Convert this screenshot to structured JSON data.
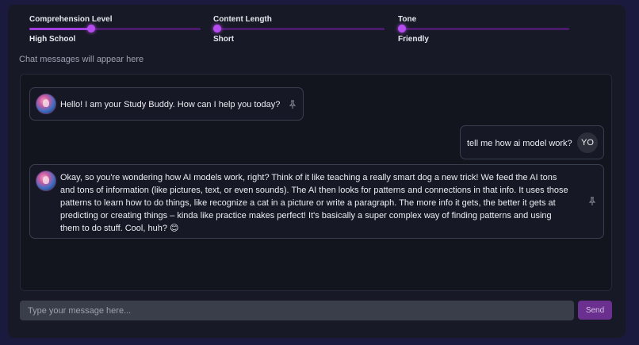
{
  "controls": {
    "comprehension": {
      "title": "Comprehension Level",
      "value": "High School",
      "level": 0.34
    },
    "length": {
      "title": "Content Length",
      "value": "Short",
      "level": 0.0
    },
    "tone": {
      "title": "Tone",
      "value": "Friendly",
      "level": 0.0
    }
  },
  "chat": {
    "hint": "Chat messages will appear here",
    "messages": [
      {
        "role": "bot",
        "text": "Hello! I am your Study Buddy. How can I help you today?"
      },
      {
        "role": "user",
        "text": "tell me how ai model work?",
        "avatar": "YO"
      },
      {
        "role": "bot",
        "lines": [
          "Okay, so you're wondering how AI models work, right? Think of it like teaching a really smart dog a new trick! We feed the AI tons",
          "and tons of information (like pictures, text, or even sounds). The AI then looks for patterns and connections in that info. It uses those",
          "patterns to learn how to do things, like recognize a cat in a picture or write a paragraph. The more info it gets, the better it gets at",
          "predicting or creating things – kinda like practice makes perfect! It's basically a super complex way of finding patterns and using",
          "them to do stuff. Cool, huh? 😊"
        ]
      }
    ]
  },
  "composer": {
    "placeholder": "Type your message here...",
    "send_label": "Send"
  },
  "colors": {
    "accent": "#a23ee0",
    "send": "#6b2f8f"
  }
}
